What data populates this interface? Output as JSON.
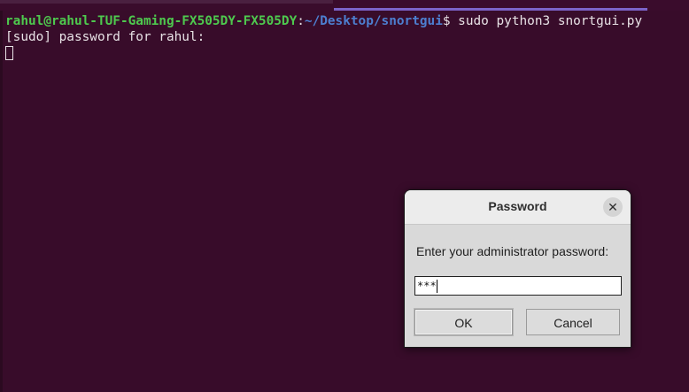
{
  "terminal": {
    "prompt_user": "rahul@rahul-TUF-Gaming-FX505DY-FX505DY",
    "prompt_sep": ":",
    "prompt_path": "~/Desktop/snortgui",
    "prompt_cmd": "$ sudo python3 snortgui.py",
    "sudo_prompt": "[sudo] password for rahul:"
  },
  "dialog": {
    "title": "Password",
    "close_glyph": "✕",
    "message": "Enter your administrator password:",
    "password_value": "***",
    "ok_label": "OK",
    "cancel_label": "Cancel"
  },
  "colors": {
    "terminal_bg": "#380c2a",
    "prompt_user": "#4ec94e",
    "prompt_path": "#4d7fd0",
    "tab_indicator": "#7b63c8"
  },
  "icons": {
    "close": "close-icon"
  }
}
